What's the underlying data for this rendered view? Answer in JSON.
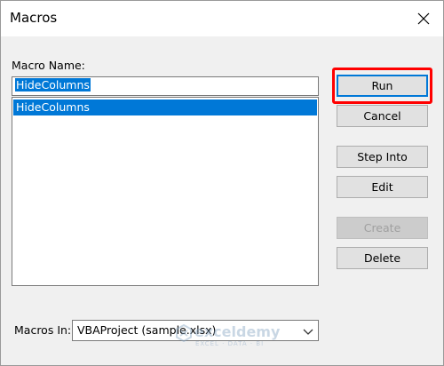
{
  "window": {
    "title": "Macros"
  },
  "macro_name": {
    "label": "Macro Name:",
    "value": "HideColumns"
  },
  "macro_list": {
    "items": [
      "HideColumns"
    ],
    "selected": "HideColumns"
  },
  "buttons": {
    "run": "Run",
    "cancel": "Cancel",
    "step_into": "Step Into",
    "edit": "Edit",
    "create": "Create",
    "delete": "Delete"
  },
  "macros_in": {
    "label": "Macros In:",
    "value": "VBAProject (sample.xlsx)"
  },
  "watermark": {
    "brand": "exceldemy",
    "tagline": "EXCEL · DATA · BI"
  },
  "colors": {
    "selection": "#0078d7",
    "highlight": "#ff0000"
  },
  "icons": {
    "close": "close-icon",
    "dropdown": "chevron-down-icon"
  }
}
